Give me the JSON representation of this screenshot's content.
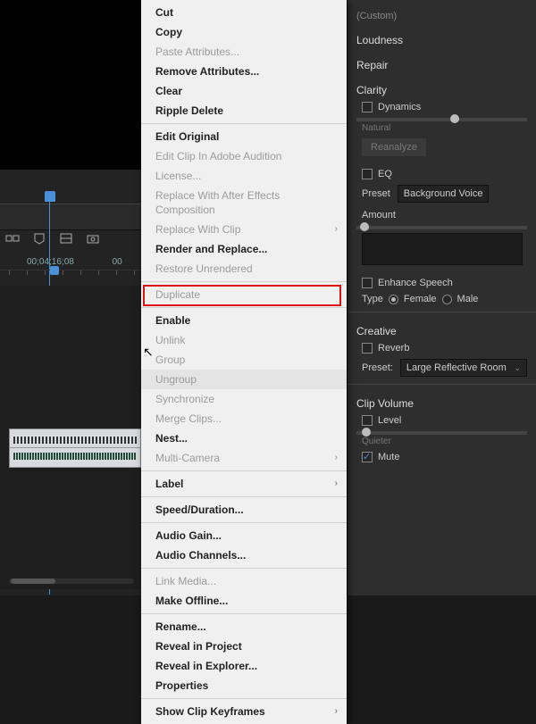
{
  "timeline": {
    "timecode": "00;04;16;08",
    "partial_tc": "00"
  },
  "panel": {
    "preset_label": "",
    "preset_value": "(Custom)",
    "loudness": "Loudness",
    "repair": "Repair",
    "clarity": "Clarity",
    "dynamics": "Dynamics",
    "natural": "Natural",
    "reanalyze": "Reanalyze",
    "eq": "EQ",
    "preset2_label": "Preset",
    "preset2_value": "Background Voice",
    "amount": "Amount",
    "enhance": "Enhance Speech",
    "type": "Type",
    "female": "Female",
    "male": "Male",
    "creative": "Creative",
    "reverb": "Reverb",
    "preset3_label": "Preset:",
    "preset3_value": "Large Reflective Room",
    "clip_volume": "Clip Volume",
    "level": "Level",
    "quieter": "Quieter",
    "mute": "Mute"
  },
  "menu": {
    "cut": "Cut",
    "copy": "Copy",
    "paste_attr": "Paste Attributes...",
    "remove_attr": "Remove Attributes...",
    "clear": "Clear",
    "ripple_delete": "Ripple Delete",
    "edit_original": "Edit Original",
    "edit_audition": "Edit Clip In Adobe Audition",
    "license": "License...",
    "replace_ae": "Replace With After Effects Composition",
    "replace_clip": "Replace With Clip",
    "render_replace": "Render and Replace...",
    "restore_unrendered": "Restore Unrendered",
    "duplicate": "Duplicate",
    "enable": "Enable",
    "unlink": "Unlink",
    "group": "Group",
    "ungroup": "Ungroup",
    "synchronize": "Synchronize",
    "merge": "Merge Clips...",
    "nest": "Nest...",
    "multicam": "Multi-Camera",
    "label": "Label",
    "speed": "Speed/Duration...",
    "audio_gain": "Audio Gain...",
    "audio_channels": "Audio Channels...",
    "link_media": "Link Media...",
    "make_offline": "Make Offline...",
    "rename": "Rename...",
    "reveal_project": "Reveal in Project",
    "reveal_explorer": "Reveal in Explorer...",
    "properties": "Properties",
    "show_keyframes": "Show Clip Keyframes"
  }
}
